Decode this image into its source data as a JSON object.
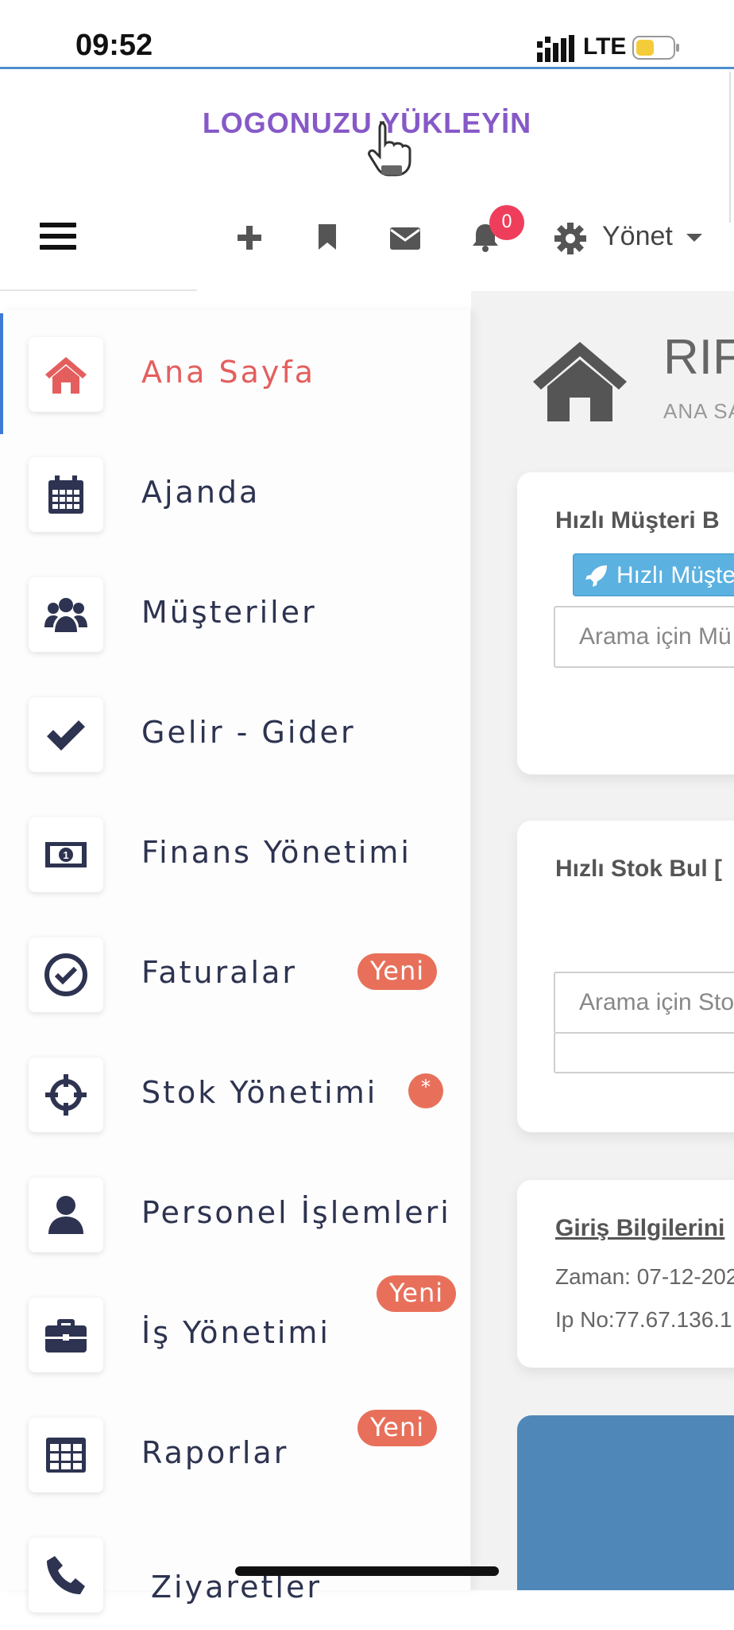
{
  "status_bar": {
    "time": "09:52",
    "network": "LTE"
  },
  "logo": {
    "text_a": "LOGONUZU ",
    "text_b": "YÜKLEYİN"
  },
  "topnav": {
    "notification_count": "0",
    "manage_label": "Yönet",
    "icons": [
      "bars-icon",
      "plus-icon",
      "bookmark-icon",
      "envelope-icon",
      "bell-icon",
      "gear-icon"
    ]
  },
  "sidebar": {
    "items": [
      {
        "label": "Ana Sayfa",
        "icon": "home-icon",
        "active": true
      },
      {
        "label": "Ajanda",
        "icon": "calendar-icon"
      },
      {
        "label": "Müşteriler",
        "icon": "users-icon"
      },
      {
        "label": "Gelir - Gider",
        "icon": "check-icon"
      },
      {
        "label": "Finans Yönetimi",
        "icon": "money-bill-icon"
      },
      {
        "label": "Faturalar",
        "icon": "check-circle-icon",
        "badge": "Yeni"
      },
      {
        "label": "Stok Yönetimi",
        "icon": "crosshairs-icon",
        "badge": "*"
      },
      {
        "label": "Personel İşlemleri",
        "icon": "user-icon"
      },
      {
        "label": "İş Yönetimi",
        "icon": "briefcase-icon",
        "badge": "Yeni"
      },
      {
        "label": "Raporlar",
        "icon": "table-icon",
        "badge": "Yeni"
      },
      {
        "label": "Ziyaretler",
        "icon": "phone-icon"
      }
    ]
  },
  "main": {
    "title": "RIF",
    "subtitle": "ANA SA",
    "card1": {
      "title": "Hızlı Müşteri B",
      "button": "Hızlı Müşte",
      "input_placeholder": "Arama için Mü"
    },
    "card2": {
      "title": "Hızlı Stok Bul [",
      "input_placeholder": "Arama için Sto"
    },
    "card3": {
      "title": "Giriş Bilgilerini",
      "time_line": "Zaman: 07-12-202",
      "ip_line": "Ip No:77.67.136.1"
    }
  },
  "colors": {
    "accent_blue": "#4f8ed0",
    "active_red": "#e45e5e",
    "badge_orange": "#e8705b",
    "brand_purple": "#6b4aa0"
  }
}
